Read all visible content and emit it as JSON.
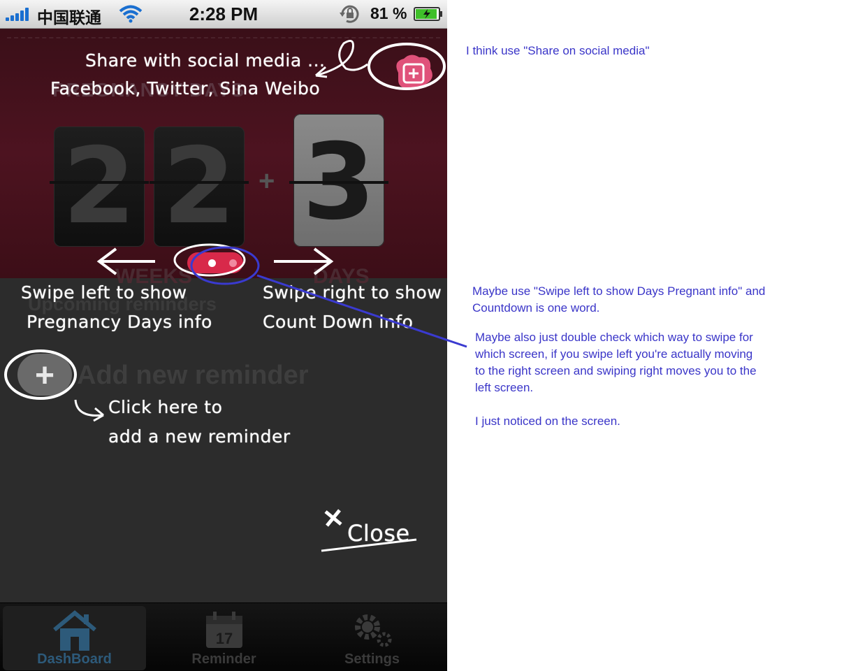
{
  "statusbar": {
    "carrier": "中国联通",
    "time": "2:28 PM",
    "battery_percent": "81 %"
  },
  "dashboard": {
    "title": "PREGNANCY DAYS",
    "weeks_digits": [
      "2",
      "2"
    ],
    "plus": "+",
    "days_digit": "3",
    "weeks_label": "WEEKS",
    "days_label": "DAYS",
    "section_title": "Upcoming reminders",
    "add_reminder_label": "Add new reminder"
  },
  "tabbar": {
    "tabs": [
      {
        "label": "DashBoard",
        "icon": "house-icon",
        "active": true
      },
      {
        "label": "Reminder",
        "icon": "calendar-icon",
        "badge": "17",
        "active": false
      },
      {
        "label": "Settings",
        "icon": "gear-icon",
        "active": false
      }
    ]
  },
  "overlay": {
    "share_line1": "Share with social media ...",
    "share_line2": "Facebook, Twitter, Sina Weibo",
    "swipe_left_line1": "Swipe left to show",
    "swipe_left_line2": "Pregnancy Days info",
    "swipe_right_line1": "Swipe right to show",
    "swipe_right_line2": "Count Down info",
    "add_hint_line1": "Click here to",
    "add_hint_line2": "add a new reminder",
    "close_label": "Close",
    "colors": {
      "annotation": "#ffffff",
      "pen": "#3a3ad0",
      "accent": "#d8294a"
    }
  },
  "comments": {
    "c1": "I think use \"Share on social media\"",
    "c2": "Maybe use \"Swipe left to show Days Pregnant info\" and\nCountdown is one word.",
    "c3": "Maybe also just double check which way to swipe for\nwhich screen, if you swipe left you're actually moving\nto the right screen and swiping right moves you to the\nleft screen.",
    "c4": "I just noticed on the screen."
  }
}
